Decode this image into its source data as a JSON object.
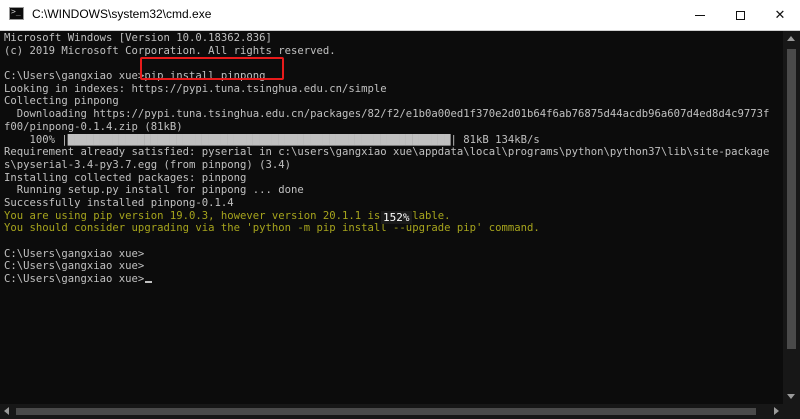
{
  "window": {
    "title": "C:\\WINDOWS\\system32\\cmd.exe",
    "controls": {
      "minimize": "minimize",
      "maximize": "maximize",
      "close": "✕"
    }
  },
  "console": {
    "lines": [
      "Microsoft Windows [Version 10.0.18362.836]",
      "(c) 2019 Microsoft Corporation. All rights reserved.",
      "",
      "C:\\Users\\gangxiao xue>pip install pinpong",
      "Looking in indexes: https://pypi.tuna.tsinghua.edu.cn/simple",
      "Collecting pinpong",
      "  Downloading https://pypi.tuna.tsinghua.edu.cn/packages/82/f2/e1b0a00ed1f370e2d01b64f6ab76875d44acdb96a607d4ed8d4c9773f",
      "f00/pinpong-0.1.4.zip (81kB)",
      "    100% |████████████████████████████████████████████████████████████| 81kB 134kB/s",
      "Requirement already satisfied: pyserial in c:\\users\\gangxiao xue\\appdata\\local\\programs\\python\\python37\\lib\\site-package",
      "s\\pyserial-3.4-py3.7.egg (from pinpong) (3.4)",
      "Installing collected packages: pinpong",
      "  Running setup.py install for pinpong ... done",
      "Successfully installed pinpong-0.1.4",
      "You are using pip version 19.0.3, however version 20.1.1 is available.",
      "You should consider upgrading via the 'python -m pip install --upgrade pip' command.",
      "",
      "C:\\Users\\gangxiao xue>",
      "C:\\Users\\gangxiao xue>",
      "C:\\Users\\gangxiao xue>"
    ],
    "zoom_overlay": "152%",
    "colors": {
      "background": "#0c0c0c",
      "text": "#c0c0c0",
      "warning_text": "#a6a41d",
      "highlight_border": "#e81b1b"
    }
  }
}
